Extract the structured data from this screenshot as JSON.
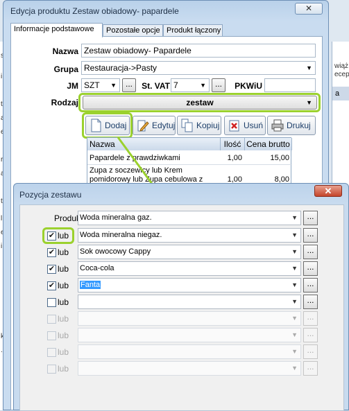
{
  "main_window": {
    "title": "Edycja produktu Zestaw obiadowy- papardele",
    "close": "✕",
    "tabs": [
      "Informacje podstawowe",
      "Pozostałe opcje",
      "Produkt łączony"
    ],
    "fields": {
      "nazwa_label": "Nazwa",
      "nazwa_value": "Zestaw obiadowy- Papardele",
      "grupa_label": "Grupa",
      "grupa_value": "Restauracja->Pasty",
      "jm_label": "JM",
      "jm_value": "SZT",
      "vat_label": "St. VAT",
      "vat_value": "7",
      "pkwiu_label": "PKWiU",
      "pkwiu_value": "",
      "rodzaj_label": "Rodzaj",
      "rodzaj_value": "zestaw"
    },
    "ellipsis": "...",
    "toolbar": {
      "add": "Dodaj",
      "edit": "Edytuj",
      "copy": "Kopiuj",
      "delete": "Usuń",
      "print": "Drukuj"
    },
    "grid": {
      "headers": [
        "Nazwa",
        "Ilość",
        "Cena brutto"
      ],
      "rows": [
        {
          "name": "Papardele z prawdziwkami",
          "qty": "1,00",
          "price": "15,00"
        },
        {
          "name_line1": "Zupa z soczewicy lub Krem",
          "name_line2": "pomidorowy lub Zupa cebulowa z",
          "qty": "1,00",
          "price": "8,00"
        }
      ]
    }
  },
  "background": {
    "right_text_1": "wiąż",
    "right_text_2": "ecep",
    "right_header": "a",
    "left_letters": [
      "s",
      "i",
      "t",
      "a",
      "e",
      "r",
      "a",
      "t",
      "l",
      "e",
      "i",
      "k",
      "."
    ]
  },
  "dialog": {
    "title": "Pozycja zestawu",
    "close": "✕",
    "product_label": "Produkt",
    "product_value": "Woda mineralna gaz.",
    "ellipsis": "...",
    "or_label": "lub",
    "alternatives": [
      {
        "checked": true,
        "enabled": true,
        "value": "Woda mineralna niegaz."
      },
      {
        "checked": true,
        "enabled": true,
        "value": "Sok owocowy Cappy"
      },
      {
        "checked": true,
        "enabled": true,
        "value": "Coca-cola"
      },
      {
        "checked": true,
        "enabled": true,
        "value": "Fanta",
        "selected": true
      },
      {
        "checked": false,
        "enabled": true,
        "value": ""
      },
      {
        "checked": false,
        "enabled": false,
        "value": ""
      },
      {
        "checked": false,
        "enabled": false,
        "value": ""
      },
      {
        "checked": false,
        "enabled": false,
        "value": ""
      },
      {
        "checked": false,
        "enabled": false,
        "value": ""
      }
    ]
  },
  "colors": {
    "highlight": "#9bd12e",
    "selection": "#3399ff",
    "close_red": "#c4452b"
  }
}
